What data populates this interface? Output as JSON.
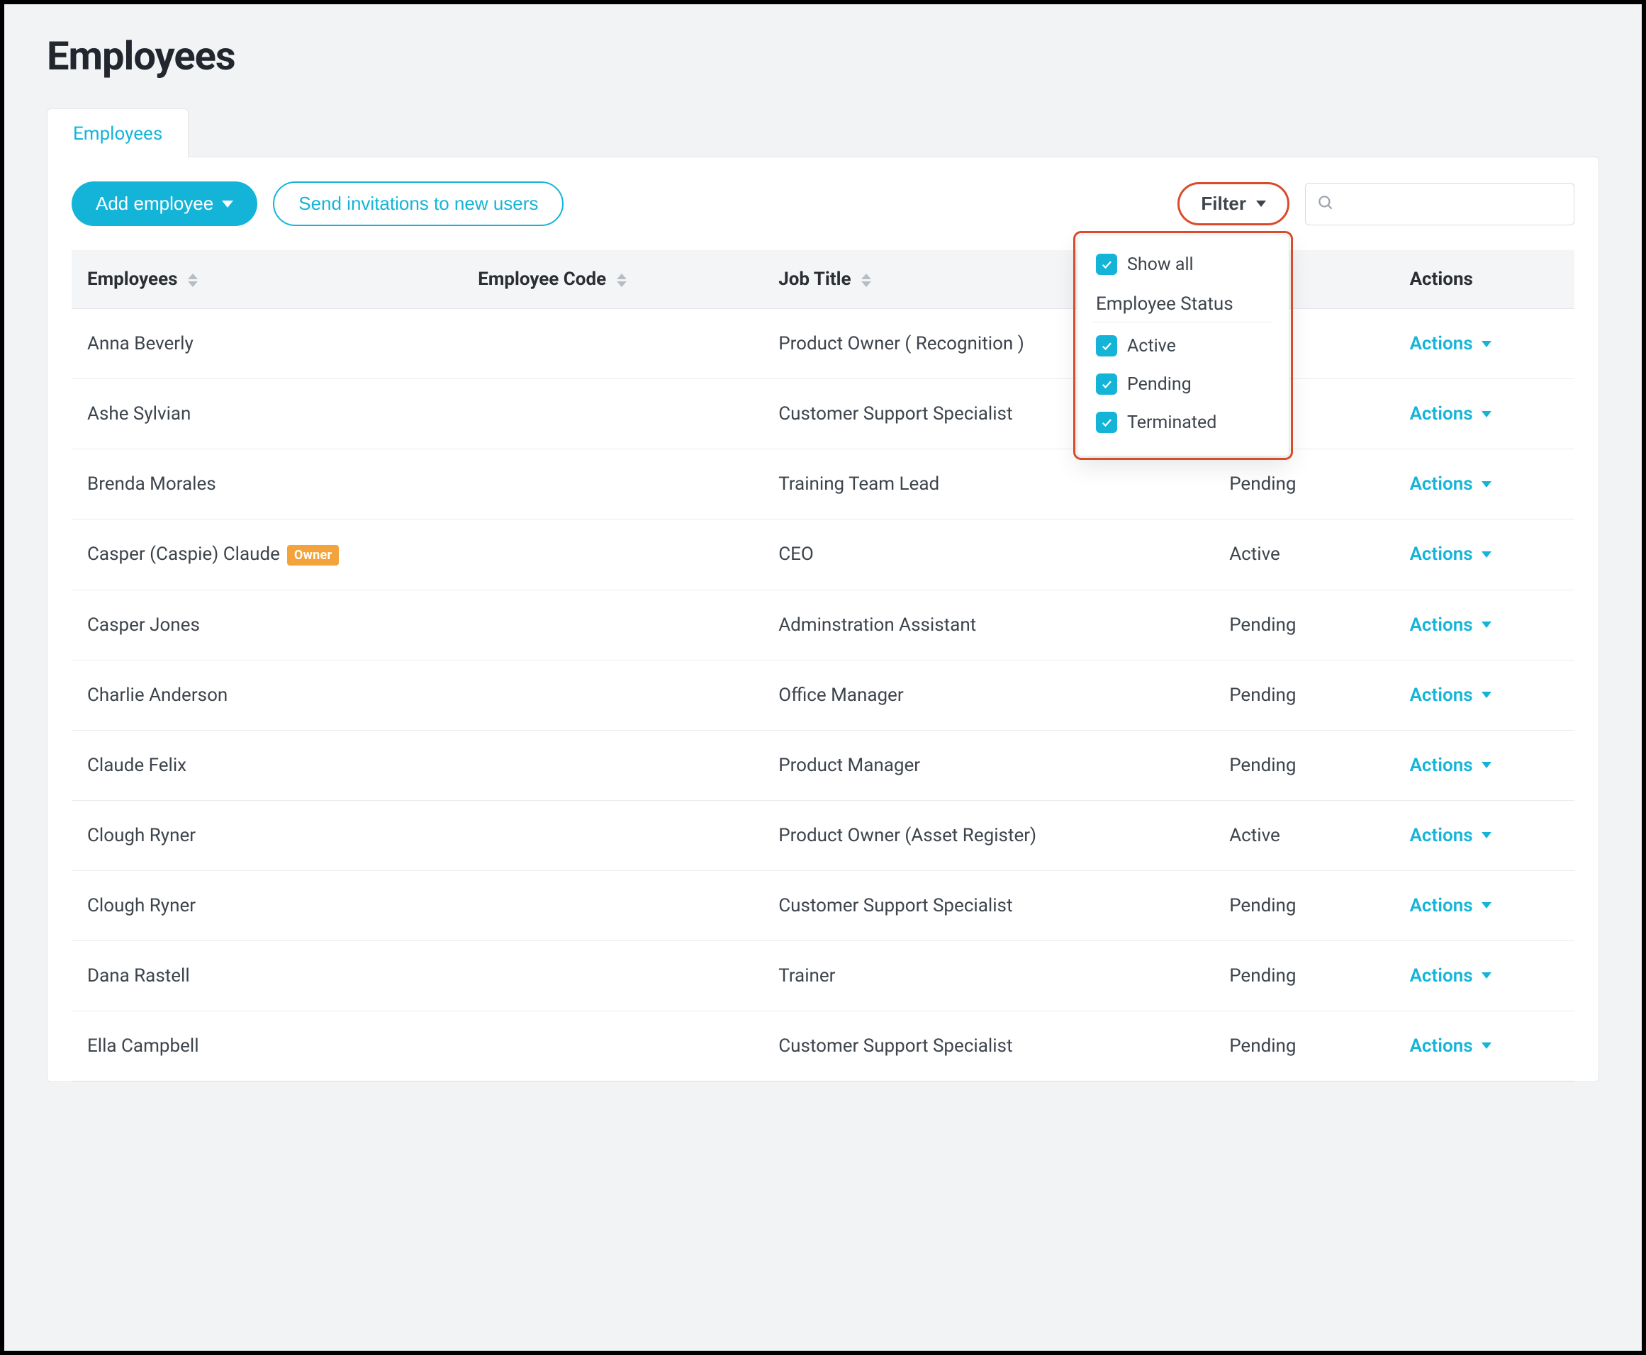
{
  "page": {
    "title": "Employees"
  },
  "tabs": [
    {
      "label": "Employees"
    }
  ],
  "toolbar": {
    "add_label": "Add employee",
    "invite_label": "Send invitations to new users",
    "filter_label": "Filter",
    "search_placeholder": ""
  },
  "filter_dropdown": {
    "show_all_label": "Show all",
    "group_label": "Employee Status",
    "options": [
      {
        "label": "Active",
        "checked": true
      },
      {
        "label": "Pending",
        "checked": true
      },
      {
        "label": "Terminated",
        "checked": true
      }
    ]
  },
  "columns": {
    "employees": "Employees",
    "employee_code": "Employee Code",
    "job_title": "Job Title",
    "status": "",
    "actions": "Actions"
  },
  "actions_label": "Actions",
  "owner_badge": "Owner",
  "rows": [
    {
      "name": "Anna Beverly",
      "code": "",
      "title": "Product Owner ( Recognition )",
      "status": "",
      "owner": false
    },
    {
      "name": "Ashe Sylvian",
      "code": "",
      "title": "Customer Support Specialist",
      "status": "",
      "owner": false
    },
    {
      "name": "Brenda Morales",
      "code": "",
      "title": "Training Team Lead",
      "status": "Pending",
      "owner": false
    },
    {
      "name": "Casper (Caspie) Claude",
      "code": "",
      "title": "CEO",
      "status": "Active",
      "owner": true
    },
    {
      "name": "Casper Jones",
      "code": "",
      "title": "Adminstration Assistant",
      "status": "Pending",
      "owner": false
    },
    {
      "name": "Charlie Anderson",
      "code": "",
      "title": "Office Manager",
      "status": "Pending",
      "owner": false
    },
    {
      "name": "Claude Felix",
      "code": "",
      "title": "Product Manager",
      "status": "Pending",
      "owner": false
    },
    {
      "name": "Clough Ryner",
      "code": "",
      "title": "Product Owner (Asset Register)",
      "status": "Active",
      "owner": false
    },
    {
      "name": "Clough Ryner",
      "code": "",
      "title": "Customer Support Specialist",
      "status": "Pending",
      "owner": false
    },
    {
      "name": "Dana Rastell",
      "code": "",
      "title": "Trainer",
      "status": "Pending",
      "owner": false
    },
    {
      "name": "Ella Campbell",
      "code": "",
      "title": "Customer Support Specialist",
      "status": "Pending",
      "owner": false
    }
  ]
}
